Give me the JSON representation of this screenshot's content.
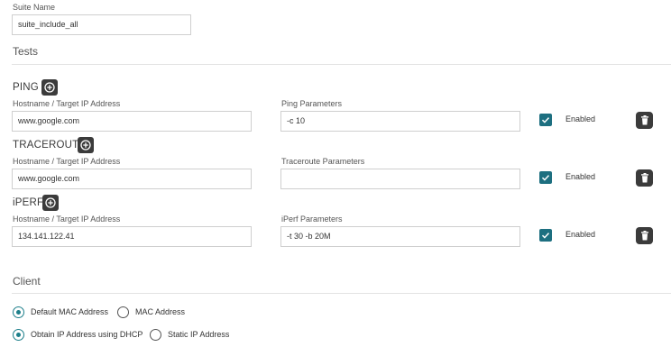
{
  "suite": {
    "name_label": "Suite Name",
    "name_value": "suite_include_all"
  },
  "tests": {
    "section_title": "Tests",
    "rows": [
      {
        "name": "PING",
        "host_label": "Hostname / Target IP Address",
        "host_value": "www.google.com",
        "params_label": "Ping Parameters",
        "params_value": "-c 10",
        "enabled_label": "Enabled",
        "enabled": true
      },
      {
        "name": "TRACEROUTE",
        "host_label": "Hostname / Target IP Address",
        "host_value": "www.google.com",
        "params_label": "Traceroute Parameters",
        "params_value": "",
        "enabled_label": "Enabled",
        "enabled": true
      },
      {
        "name": "iPERF",
        "host_label": "Hostname / Target IP Address",
        "host_value": "134.141.122.41",
        "params_label": "iPerf Parameters",
        "params_value": "-t 30 -b 20M",
        "enabled_label": "Enabled",
        "enabled": true
      }
    ]
  },
  "client": {
    "section_title": "Client",
    "mac_options": [
      "Default MAC Address",
      "MAC Address"
    ],
    "mac_selected": "Default MAC Address",
    "ip_options": [
      "Obtain IP Address using DHCP",
      "Static IP Address"
    ],
    "ip_selected": "Obtain IP Address using DHCP"
  },
  "colors": {
    "accent": "#1d6f80",
    "icon_button": "#3b3b3b"
  },
  "icons": {
    "add": "plus-circle-icon",
    "delete": "trash-icon",
    "check": "check-icon"
  }
}
